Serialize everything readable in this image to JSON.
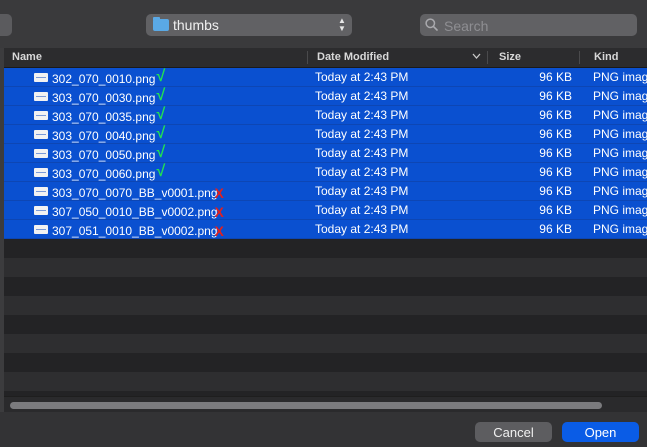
{
  "toolbar": {
    "folder_name": "thumbs",
    "search_placeholder": "Search"
  },
  "columns": {
    "name": "Name",
    "date_modified": "Date Modified",
    "size": "Size",
    "kind": "Kind"
  },
  "files": [
    {
      "name": "302_070_0010.png",
      "mark": "√",
      "date": "Today at 2:43 PM",
      "size": "96 KB",
      "kind": "PNG imag"
    },
    {
      "name": "303_070_0030.png",
      "mark": "√",
      "date": "Today at 2:43 PM",
      "size": "96 KB",
      "kind": "PNG imag"
    },
    {
      "name": "303_070_0035.png",
      "mark": "√",
      "date": "Today at 2:43 PM",
      "size": "96 KB",
      "kind": "PNG imag"
    },
    {
      "name": "303_070_0040.png",
      "mark": "√",
      "date": "Today at 2:43 PM",
      "size": "96 KB",
      "kind": "PNG imag"
    },
    {
      "name": "303_070_0050.png",
      "mark": "√",
      "date": "Today at 2:43 PM",
      "size": "96 KB",
      "kind": "PNG imag"
    },
    {
      "name": "303_070_0060.png",
      "mark": "√",
      "date": "Today at 2:43 PM",
      "size": "96 KB",
      "kind": "PNG imag"
    },
    {
      "name": "303_070_0070_BB_v0001.png",
      "mark": "X",
      "date": "Today at 2:43 PM",
      "size": "96 KB",
      "kind": "PNG imag"
    },
    {
      "name": "307_050_0010_BB_v0002.png",
      "mark": "X",
      "date": "Today at 2:43 PM",
      "size": "96 KB",
      "kind": "PNG imag"
    },
    {
      "name": "307_051_0010_BB_v0002.png",
      "mark": "X",
      "date": "Today at 2:43 PM",
      "size": "96 KB",
      "kind": "PNG imag"
    }
  ],
  "colors": {
    "selection": "#0a50d0",
    "check_mark": "#22e052",
    "cross_mark": "#e02020",
    "primary_button": "#0a5ce6"
  },
  "footer": {
    "cancel_label": "Cancel",
    "open_label": "Open"
  }
}
